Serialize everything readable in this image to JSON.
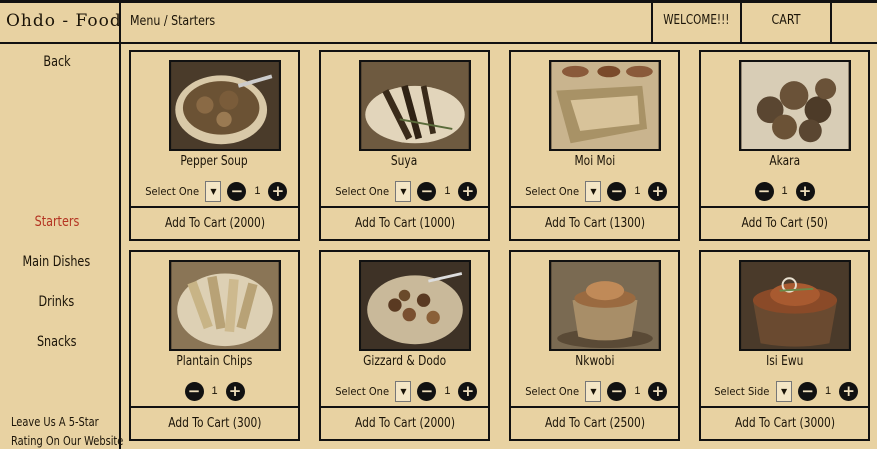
{
  "header": {
    "brand": "Ohdo - Food",
    "breadcrumb": "Menu / Starters",
    "welcome": "WELCOME!!!",
    "cart": "CART"
  },
  "sidebar": {
    "back": "Back",
    "items": [
      {
        "label": "Starters",
        "active": true
      },
      {
        "label": "Main Dishes",
        "active": false
      },
      {
        "label": "Drinks",
        "active": false
      },
      {
        "label": "Snacks",
        "active": false
      }
    ],
    "rating_line1": "Leave Us A 5-Star",
    "rating_line2": "Rating On Our Website"
  },
  "colors": {
    "background": "#e8d2a2",
    "active_nav": "#b43422",
    "border": "#111111"
  },
  "products": [
    {
      "name": "Pepper Soup",
      "select": "Select One",
      "qty": "1",
      "add": "Add To Cart (2000)",
      "image": "bowl-of-soup"
    },
    {
      "name": "Suya",
      "select": "Select One",
      "qty": "1",
      "add": "Add To Cart (1000)",
      "image": "skewered-meat"
    },
    {
      "name": "Moi Moi",
      "select": "Select One",
      "qty": "1",
      "add": "Add To Cart (1300)",
      "image": "wrapped-moi-moi"
    },
    {
      "name": "Akara",
      "select": "",
      "qty": "1",
      "add": "Add To Cart (50)",
      "image": "bean-fritters"
    },
    {
      "name": "Plantain Chips",
      "select": "",
      "qty": "1",
      "add": "Add To Cart (300)",
      "image": "plantain-chips"
    },
    {
      "name": "Gizzard & Dodo",
      "select": "Select One",
      "qty": "1",
      "add": "Add To Cart (2000)",
      "image": "gizzard-dodo"
    },
    {
      "name": "Nkwobi",
      "select": "Select One",
      "qty": "1",
      "add": "Add To Cart (2500)",
      "image": "clay-pot-nkwobi"
    },
    {
      "name": "Isi Ewu",
      "select": "Select Side",
      "qty": "1",
      "add": "Add To Cart (3000)",
      "image": "isi-ewu-pot"
    }
  ],
  "icons": {
    "minus": "minus-icon",
    "plus": "plus-icon",
    "dropdown": "chevron-down-icon"
  }
}
